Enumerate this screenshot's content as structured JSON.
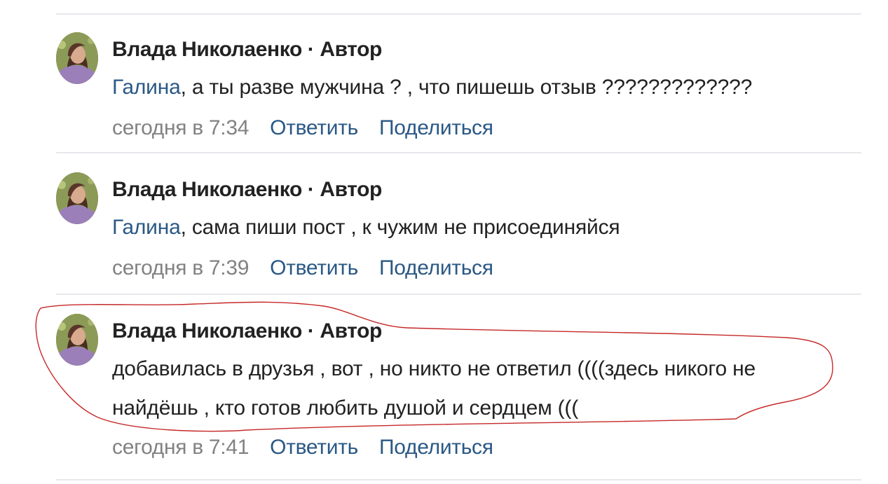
{
  "colors": {
    "text": "#222222",
    "muted": "#828282",
    "link": "#2a5885",
    "divider": "#e7e8ec",
    "annotation": "#c62828"
  },
  "comments": [
    {
      "author": "Влада Николаенко · Автор",
      "mention": "Галина",
      "text": ", а ты разве мужчина ? , что пишешь отзыв ?????????????",
      "time": "сегодня в 7:34",
      "reply": "Ответить",
      "share": "Поделиться"
    },
    {
      "author": "Влада Николаенко · Автор",
      "mention": "Галина",
      "text": ", сама пиши пост , к чужим не присоединяйся",
      "time": "сегодня в 7:39",
      "reply": "Ответить",
      "share": "Поделиться"
    },
    {
      "author": "Влада Николаенко · Автор",
      "text_line_1": "добавилась в друзья , вот , но никто не ответил ((((здесь никого не",
      "text_line_2": "найдёшь , кто готов любить душой и сердцем (((",
      "time": "сегодня в 7:41",
      "reply": "Ответить",
      "share": "Поделиться"
    }
  ]
}
